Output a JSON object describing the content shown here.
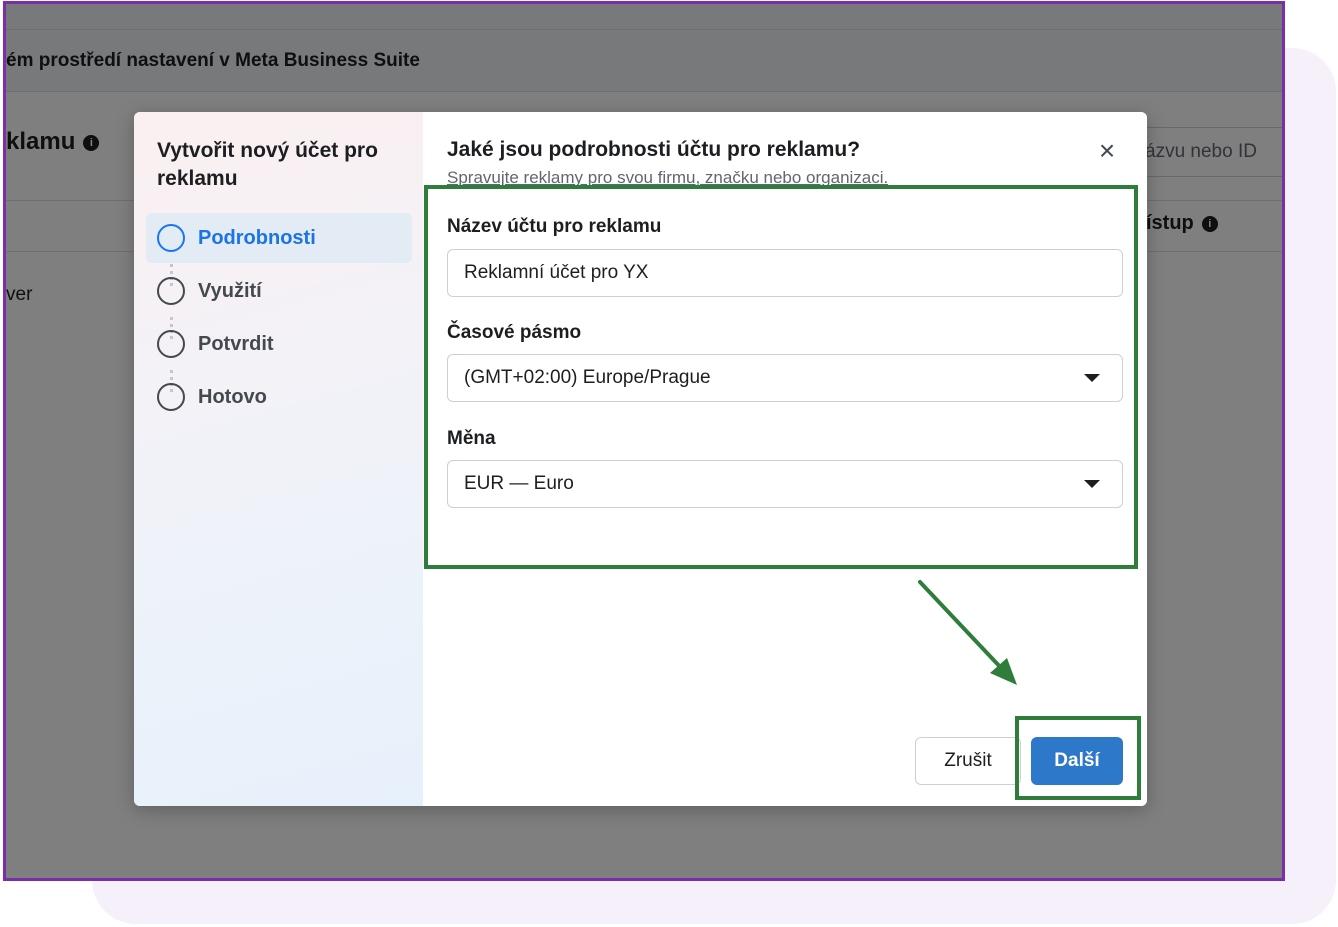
{
  "background": {
    "banner_text": "ém prostředí nastavení v Meta Business Suite",
    "page_heading": "klamu",
    "search_placeholder": "ázvu nebo ID",
    "column_access": "ístup",
    "row_text": "ver",
    "info_glyph": "i"
  },
  "sidebar": {
    "title": "Vytvořit nový účet pro reklamu",
    "steps": [
      {
        "label": "Podrobnosti",
        "active": true
      },
      {
        "label": "Využití",
        "active": false
      },
      {
        "label": "Potvrdit",
        "active": false
      },
      {
        "label": "Hotovo",
        "active": false
      }
    ]
  },
  "main": {
    "title": "Jaké jsou podrobnosti účtu pro reklamu?",
    "subtitle": "Spravujte reklamy pro svou firmu, značku nebo organizaci.",
    "close_glyph": "×",
    "fields": {
      "account_name_label": "Název účtu pro reklamu",
      "account_name_value": "Reklamní účet pro YX",
      "timezone_label": "Časové pásmo",
      "timezone_value": "(GMT+02:00) Europe/Prague",
      "currency_label": "Měna",
      "currency_value": "EUR — Euro"
    },
    "buttons": {
      "cancel": "Zrušit",
      "next": "Další"
    }
  },
  "colors": {
    "accent": "#1877f2",
    "primary_button": "#2d78c8",
    "highlight_annotation": "#2e7d3a",
    "frame_border": "#7a2fa8"
  },
  "icons": [
    "info-icon",
    "close-icon",
    "chevron-down-icon",
    "arrow-annotation-icon"
  ]
}
